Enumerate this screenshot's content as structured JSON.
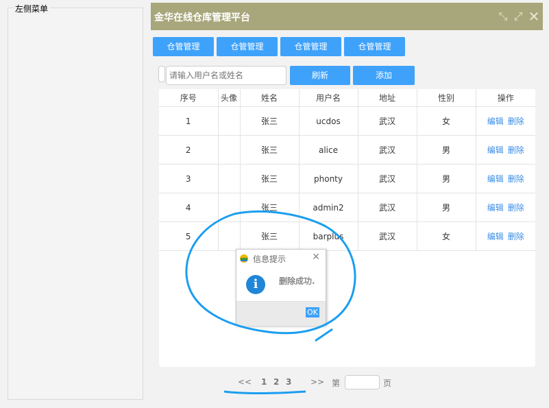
{
  "left_menu": {
    "title": "左侧菜单"
  },
  "header": {
    "title": "金华在线仓库管理平台"
  },
  "tabs": [
    {
      "label": "仓管管理"
    },
    {
      "label": "仓管管理"
    },
    {
      "label": "仓管管理"
    },
    {
      "label": "仓管管理"
    }
  ],
  "toolbar": {
    "search_placeholder": "请输入用户名或姓名",
    "refresh_label": "刷新",
    "add_label": "添加"
  },
  "table": {
    "columns": [
      "序号",
      "头像",
      "姓名",
      "用户名",
      "地址",
      "性别",
      "操作"
    ],
    "edit_label": "编辑",
    "delete_label": "删除",
    "rows": [
      {
        "index": "1",
        "avatar": "",
        "name": "张三",
        "username": "ucdos",
        "address": "武汉",
        "gender": "女"
      },
      {
        "index": "2",
        "avatar": "",
        "name": "张三",
        "username": "alice",
        "address": "武汉",
        "gender": "男"
      },
      {
        "index": "3",
        "avatar": "",
        "name": "张三",
        "username": "phonty",
        "address": "武汉",
        "gender": "男"
      },
      {
        "index": "4",
        "avatar": "",
        "name": "张三",
        "username": "admin2",
        "address": "武汉",
        "gender": "男"
      },
      {
        "index": "5",
        "avatar": "",
        "name": "张三",
        "username": "barplus",
        "address": "武汉",
        "gender": "女"
      }
    ]
  },
  "pagination": {
    "prev": "<<",
    "pages": [
      "1",
      "2",
      "3"
    ],
    "next": ">>",
    "page_prefix": "第",
    "page_suffix": "页"
  },
  "dialog": {
    "title": "信息提示",
    "message": "删除成功.",
    "ok_label": "OK"
  },
  "colors": {
    "header_bg": "#a8a67b",
    "button_blue": "#3ea2fb",
    "link_blue": "#3a8ee6",
    "annotation_blue": "#1a9ef0"
  }
}
